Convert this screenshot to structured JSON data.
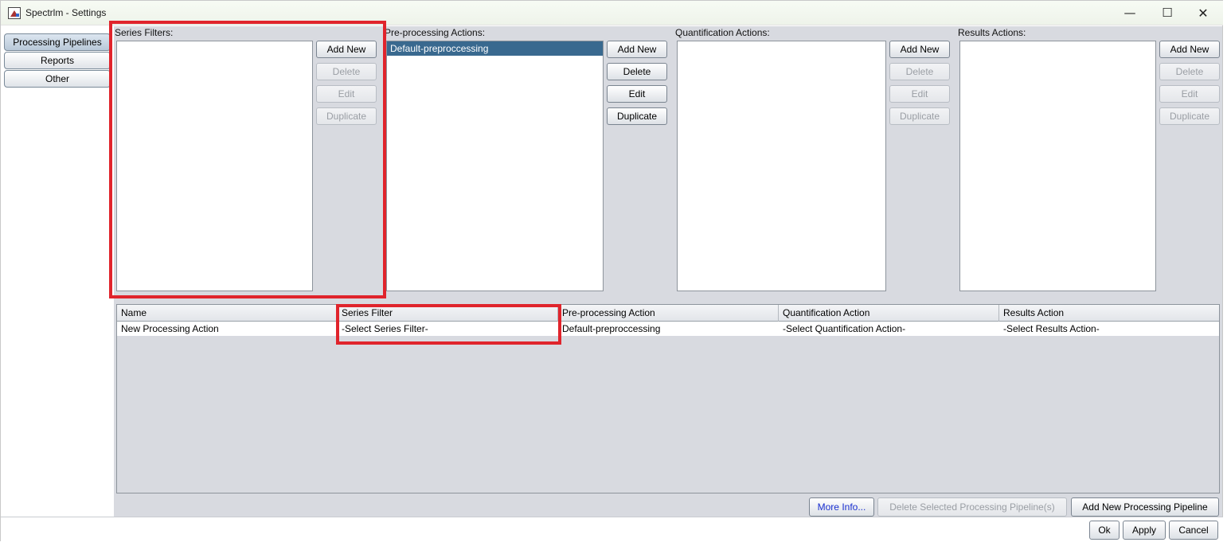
{
  "window": {
    "title": "Spectrlm - Settings",
    "minimize_glyph": "—",
    "maximize_glyph": "☐",
    "close_glyph": "✕"
  },
  "nav": {
    "tabs": [
      {
        "label": "Processing Pipelines",
        "selected": true
      },
      {
        "label": "Reports",
        "selected": false
      },
      {
        "label": "Other",
        "selected": false
      }
    ]
  },
  "sections": {
    "series_filters": {
      "label": "Series Filters:",
      "items": [],
      "buttons": {
        "add": "Add New",
        "delete": "Delete",
        "edit": "Edit",
        "duplicate": "Duplicate"
      }
    },
    "preprocessing": {
      "label": "Pre-processing Actions:",
      "items": [
        "Default-preproccessing"
      ],
      "buttons": {
        "add": "Add New",
        "delete": "Delete",
        "edit": "Edit",
        "duplicate": "Duplicate"
      }
    },
    "quantification": {
      "label": "Quantification Actions:",
      "items": [],
      "buttons": {
        "add": "Add New",
        "delete": "Delete",
        "edit": "Edit",
        "duplicate": "Duplicate"
      }
    },
    "results": {
      "label": "Results Actions:",
      "items": [],
      "buttons": {
        "add": "Add New",
        "delete": "Delete",
        "edit": "Edit",
        "duplicate": "Duplicate"
      }
    }
  },
  "table": {
    "headers": [
      "Name",
      "Series Filter",
      "Pre-processing Action",
      "Quantification Action",
      "Results Action"
    ],
    "rows": [
      [
        "New Processing Action",
        "-Select Series Filter-",
        "Default-preproccessing",
        "-Select Quantification Action-",
        "-Select Results Action-"
      ]
    ]
  },
  "actions": {
    "more_info": "More Info...",
    "delete_pipeline": "Delete Selected Processing Pipeline(s)",
    "add_pipeline": "Add New Processing Pipeline"
  },
  "footer": {
    "ok": "Ok",
    "apply": "Apply",
    "cancel": "Cancel"
  },
  "colors": {
    "highlight": "#e0242c",
    "selection": "#39698f",
    "panel": "#d8dae0"
  }
}
